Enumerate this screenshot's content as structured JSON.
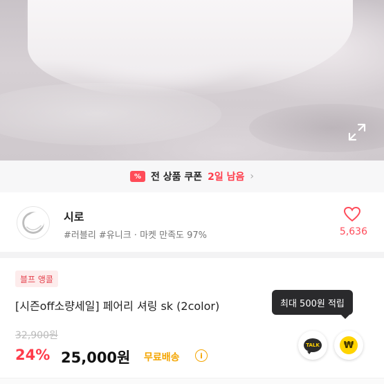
{
  "coupon": {
    "icon": "coupon-percent-icon",
    "icon_glyph": "%",
    "text": "전 상품 쿠폰",
    "highlight": "2일 남음",
    "highlight_color": "#ff3b4a"
  },
  "shop": {
    "name": "시로",
    "tags": "#러블리 #유니크 · 마켓 만족도 97%",
    "like_count": "5,636",
    "like_color": "#ff4b5a"
  },
  "product": {
    "badge": "블프 앵콜",
    "title": "[시즌off소량세일] 페어리 셔링 sk (2color)",
    "original_price": "32,900원",
    "discount": "24%",
    "price": "25,000원",
    "shipping": "무료배송",
    "info_glyph": "i"
  },
  "tooltip": {
    "text": "최대 500원 적립"
  },
  "actions": {
    "talk_label": "TALK",
    "points_glyph": "₩",
    "points_color": "#ffd400"
  }
}
